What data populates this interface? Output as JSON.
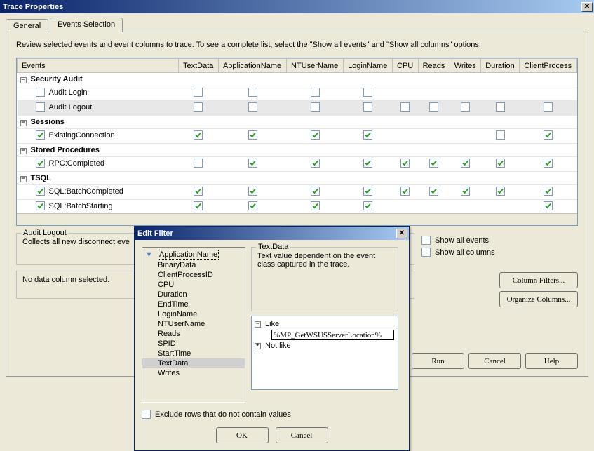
{
  "window": {
    "title": "Trace Properties"
  },
  "tabs": {
    "general": "General",
    "events": "Events Selection"
  },
  "instruction": "Review selected events and event columns to trace. To see a complete list, select the \"Show all events\" and \"Show all columns\" options.",
  "columns": [
    "Events",
    "TextData",
    "ApplicationName",
    "NTUserName",
    "LoginName",
    "CPU",
    "Reads",
    "Writes",
    "Duration",
    "ClientProcess"
  ],
  "rows": [
    {
      "type": "cat",
      "label": "Security Audit"
    },
    {
      "type": "evt",
      "label": "Audit Login",
      "checked": false,
      "cells": [
        false,
        false,
        false,
        false,
        null,
        null,
        null,
        null,
        null
      ]
    },
    {
      "type": "evt",
      "label": "Audit Logout",
      "checked": false,
      "selected": true,
      "cells": [
        false,
        false,
        false,
        false,
        false,
        false,
        false,
        false,
        false
      ]
    },
    {
      "type": "cat",
      "label": "Sessions",
      "bold": true
    },
    {
      "type": "evt",
      "label": "ExistingConnection",
      "checked": true,
      "cells": [
        true,
        true,
        true,
        true,
        null,
        null,
        null,
        false,
        true
      ]
    },
    {
      "type": "cat",
      "label": "Stored Procedures",
      "bold": true
    },
    {
      "type": "evt",
      "label": "RPC:Completed",
      "checked": true,
      "cells": [
        false,
        true,
        true,
        true,
        true,
        true,
        true,
        true,
        true
      ]
    },
    {
      "type": "cat",
      "label": "TSQL",
      "bold": true
    },
    {
      "type": "evt",
      "label": "SQL:BatchCompleted",
      "checked": true,
      "cells": [
        true,
        true,
        true,
        true,
        true,
        true,
        true,
        true,
        true
      ]
    },
    {
      "type": "evt",
      "label": "SQL:BatchStarting",
      "checked": true,
      "cells": [
        true,
        true,
        true,
        true,
        null,
        null,
        null,
        null,
        true
      ]
    }
  ],
  "detail": {
    "title": "Audit Logout",
    "desc": "Collects all new disconnect eve",
    "noColumn": "No data column selected."
  },
  "options": {
    "showEvents": "Show all events",
    "showColumns": "Show all columns",
    "colFilters": "Column Filters...",
    "organize": "Organize Columns..."
  },
  "buttons": {
    "run": "Run",
    "cancel": "Cancel",
    "help": "Help"
  },
  "dialog": {
    "title": "Edit Filter",
    "columns": [
      "ApplicationName",
      "BinaryData",
      "ClientProcessID",
      "CPU",
      "Duration",
      "EndTime",
      "LoginName",
      "NTUserName",
      "Reads",
      "SPID",
      "StartTime",
      "TextData",
      "Writes"
    ],
    "activeColumn": "ApplicationName",
    "selectedColumn": "TextData",
    "descTitle": "TextData",
    "descText": "Text value dependent on the event class captured in the trace.",
    "filter": {
      "like": "Like",
      "notlike": "Not like",
      "value": "%MP_GetWSUSServerLocation%"
    },
    "exclude": "Exclude rows that do not contain values",
    "ok": "OK",
    "cancel": "Cancel"
  }
}
